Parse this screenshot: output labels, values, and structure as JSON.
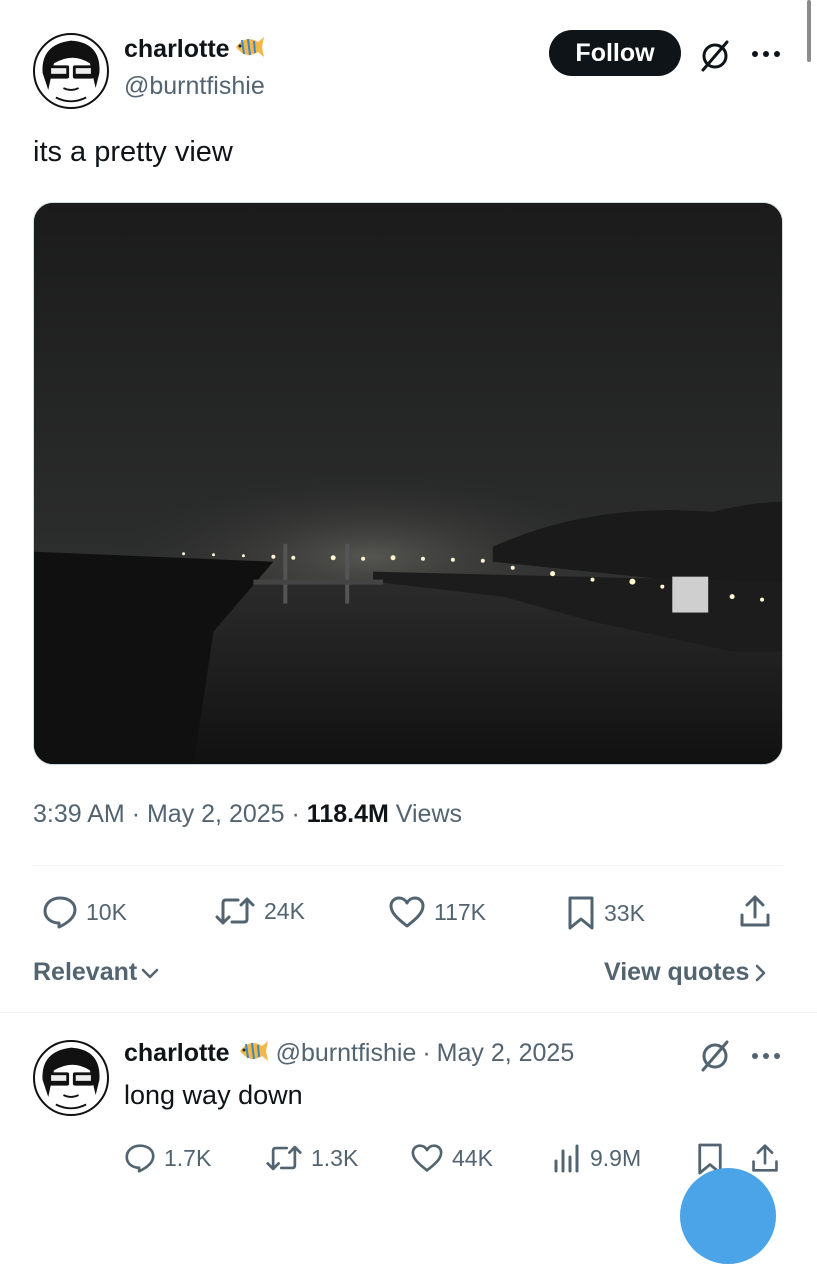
{
  "tweet": {
    "author_name": "charlotte",
    "author_handle": "@burntfishie",
    "follow_label": "Follow",
    "text": "its a pretty view",
    "time": "3:39 AM",
    "sep1": "·",
    "date": "May 2, 2025",
    "sep2": "·",
    "views_count": "118.4M",
    "views_label": "Views",
    "replies": "10K",
    "reposts": "24K",
    "likes": "117K",
    "bookmarks": "33K"
  },
  "sort": {
    "relevant_label": "Relevant",
    "view_quotes_label": "View quotes"
  },
  "reply": {
    "author_name": "charlotte",
    "author_handle": "@burntfishie",
    "sep": "·",
    "date": "May 2, 2025",
    "text": "long way down",
    "replies": "1.7K",
    "reposts": "1.3K",
    "likes": "44K",
    "views": "9.9M"
  },
  "icons": {
    "follow": "follow-button",
    "grok": "grok-icon",
    "more": "more-icon",
    "reply": "reply-icon",
    "repost": "repost-icon",
    "like": "like-icon",
    "bookmark": "bookmark-icon",
    "share": "share-icon",
    "analytics": "analytics-icon",
    "fish_emoji": "tropical-fish-icon"
  },
  "colors": {
    "text_primary": "#0f1419",
    "text_secondary": "#536471",
    "divider": "#eff3f4",
    "follow_bg": "#0f1419",
    "fab_blue": "#4ba3e8"
  }
}
